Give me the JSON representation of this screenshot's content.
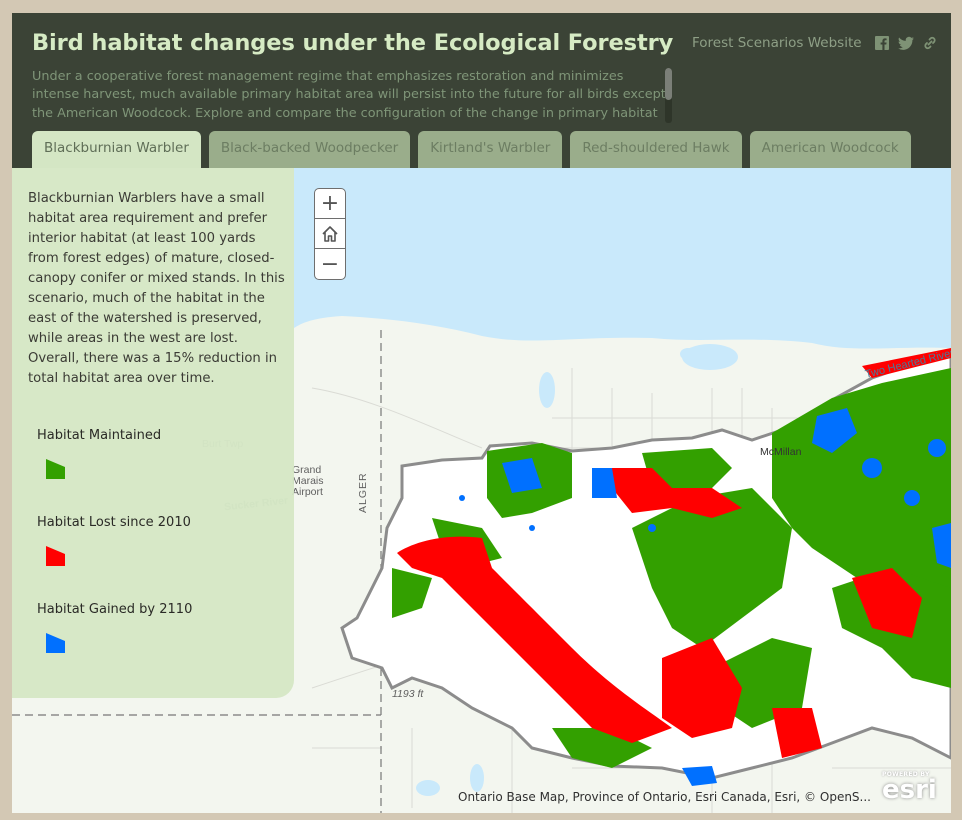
{
  "header": {
    "title": "Bird habitat changes under the Ecological Forestry Scenario",
    "subtitle": "Under a cooperative forest management regime that emphasizes restoration and minimizes intense harvest, much available primary habitat area will persist into the future for all birds except the American Woodcock. Explore and compare the configuration of the change in primary habitat availability over time",
    "website_link": "Forest Scenarios Website",
    "social_icons": [
      "facebook-icon",
      "twitter-icon",
      "link-icon"
    ]
  },
  "tabs": [
    {
      "label": "Blackburnian Warbler",
      "active": true
    },
    {
      "label": "Black-backed Woodpecker",
      "active": false
    },
    {
      "label": "Kirtland's Warbler",
      "active": false
    },
    {
      "label": "Red-shouldered Hawk",
      "active": false
    },
    {
      "label": "American Woodcock",
      "active": false
    }
  ],
  "panel": {
    "description": "Blackburnian Warblers have a small habitat area requirement and prefer interior habitat (at least 100 yards from forest edges) of mature, closed-canopy conifer or mixed stands. In this scenario, much of the habitat in the east of the watershed is preserved, while areas in the west are lost. Overall, there was a 15% reduction in total habitat area over time.",
    "legend": [
      {
        "label": "Habitat Maintained",
        "color": "#33a000"
      },
      {
        "label": "Habitat Lost since 2010",
        "color": "#ff0000"
      },
      {
        "label": "Habitat Gained by 2110",
        "color": "#0070ff"
      }
    ]
  },
  "map": {
    "zoom_in": "+",
    "zoom_out": "−",
    "home_icon": "home-icon",
    "labels": {
      "burt_twp": "Burt Twp",
      "sucker_river": "Sucker River",
      "grand_marais": [
        "Grand",
        "Marais",
        "Airport"
      ],
      "alger": "ALGER",
      "mcmillan": "McMillan",
      "two_hearted": "Two Hearted River",
      "elevation": "1193 ft"
    },
    "attribution": "Ontario Base Map, Province of Ontario, Esri Canada, Esri, © OpenS...",
    "logo": {
      "top": "POWERED BY",
      "main": "esri"
    },
    "colors": {
      "water": "#c9e9fb",
      "land": "#f3f6ef",
      "maintained": "#33a000",
      "lost": "#ff0000",
      "gained": "#0070ff",
      "boundary": "#8c8c8c"
    }
  }
}
